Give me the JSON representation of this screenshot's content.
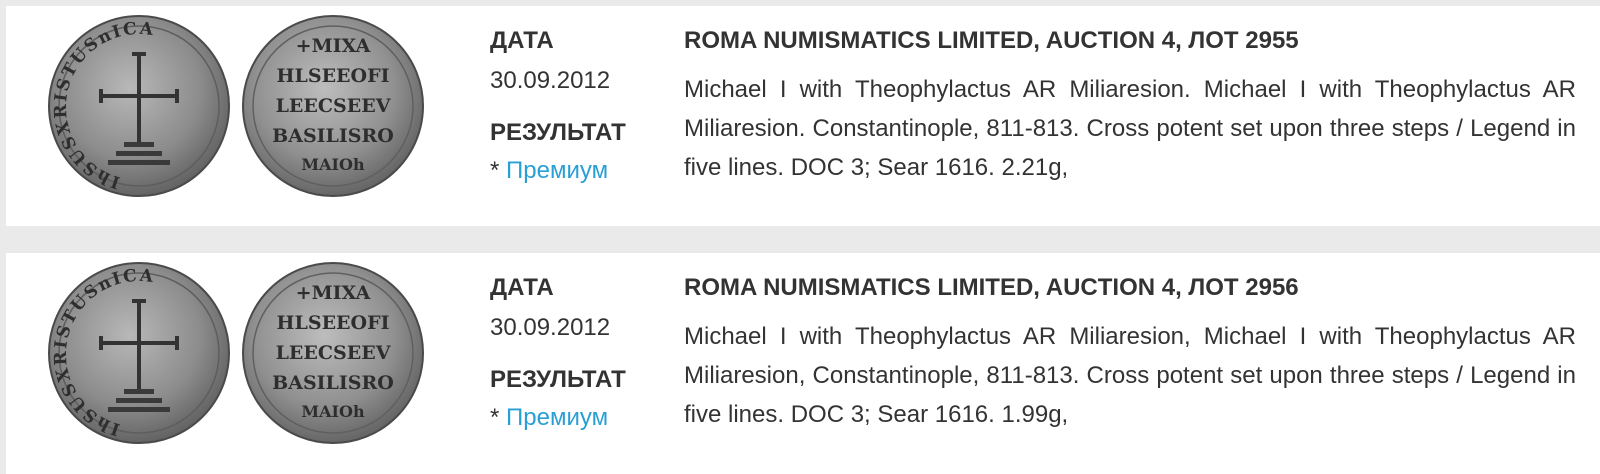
{
  "lots": [
    {
      "date_label": "ДАТА",
      "date": "30.09.2012",
      "result_label": "РЕЗУЛЬТАТ",
      "result_prefix": "* ",
      "result_link": "Премиум",
      "title": "ROMA NUMISMATICS LIMITED, AUCTION 4, ЛОТ 2955",
      "description": "Michael I with Theophylactus AR Miliaresion. Michael I with Theophylactus AR Miliaresion. Constantinople, 811-813. Cross potent set upon three steps / Legend in five lines. DOC 3; Sear 1616. 2.21g,",
      "coin_legend_obverse": "IhSUSXRISTUSnICA",
      "coin_legend_reverse": [
        "+MIXA",
        "HLSEEOFI",
        "LEECSEEV",
        "BASILISRO",
        "MAIOh"
      ]
    },
    {
      "date_label": "ДАТА",
      "date": "30.09.2012",
      "result_label": "РЕЗУЛЬТАТ",
      "result_prefix": "* ",
      "result_link": "Премиум",
      "title": "ROMA NUMISMATICS LIMITED, AUCTION 4, ЛОТ 2956",
      "description": "Michael I with Theophylactus AR Miliaresion, Michael I with Theophylactus AR Miliaresion, Constantinople, 811-813. Cross potent set upon three steps / Legend in five lines. DOC 3; Sear 1616. 1.99g,",
      "coin_legend_obverse": "IhSUSXRISTUSnICA",
      "coin_legend_reverse": [
        "+MIXA",
        "HLSEEOFI",
        "LEECSEEV",
        "BASILISRO",
        "MAIOh"
      ]
    }
  ],
  "colors": {
    "page_background": "#eaeaea",
    "card_background": "#ffffff",
    "text": "#333333",
    "link": "#2a9fd6",
    "coin_silver": "#8f8f8f"
  }
}
